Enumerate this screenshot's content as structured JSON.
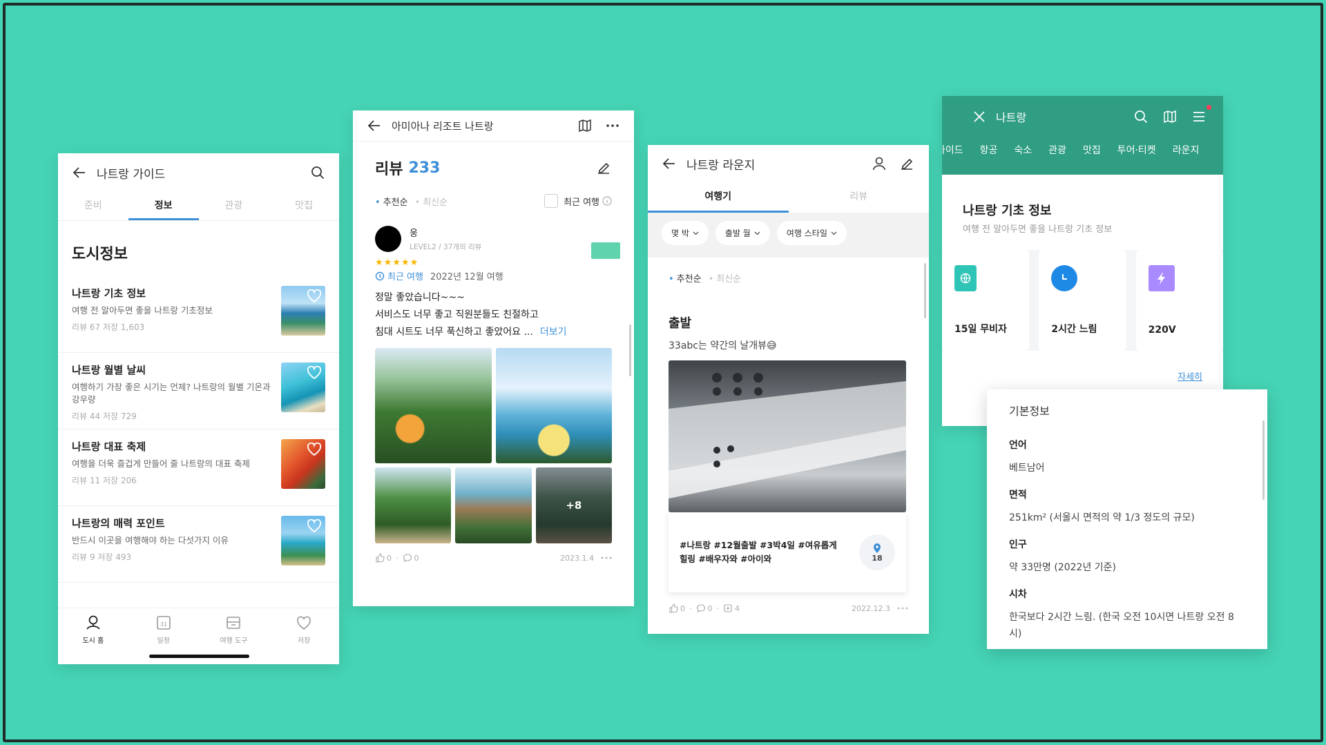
{
  "guide": {
    "title": "나트랑 가이드",
    "tabs": [
      "준비",
      "정보",
      "관광",
      "맛집"
    ],
    "active_tab": 1,
    "section_title": "도시정보",
    "items": [
      {
        "title": "나트랑 기초 정보",
        "desc": "여행 전 알아두면 좋을 나트랑 기초정보",
        "stats": "리뷰 67   저장 1,603"
      },
      {
        "title": "나트랑 월별 날씨",
        "desc": "여행하기 가장 좋은 시기는 언제? 나트랑의 월별 기온과 강우량",
        "stats": "리뷰 44   저장 729"
      },
      {
        "title": "나트랑 대표 축제",
        "desc": "여행을 더욱 즐겁게 만들어 줄 나트랑의 대표 축제",
        "stats": "리뷰 11   저장 206"
      },
      {
        "title": "나트랑의 매력 포인트",
        "desc": "반드시 이곳을 여행해야 하는 다섯가지 이유",
        "stats": "리뷰 9   저장 493"
      }
    ],
    "bottom_nav": [
      "도시 홈",
      "일정",
      "여행 도구",
      "저장"
    ],
    "calendar_day": "31"
  },
  "review": {
    "header_title": "아미아나 리조트 나트랑",
    "title": "리뷰",
    "count": "233",
    "sort_recommended": "추천순",
    "sort_latest": "최신순",
    "recent_trip_filter": "최근 여행",
    "user_name": "웅",
    "user_level": "LEVEL2 / 37개의 리뷰",
    "stars": "★★★★★",
    "recent_trip_label": "최근 여행",
    "trip_date": "2022년 12월 여행",
    "body_lines": [
      "정말 좋았습니다~~~",
      "서비스도 너무 좋고 직원분들도 친절하고",
      "침대 시트도 너무 푹신하고 좋았어요 ..."
    ],
    "more": "더보기",
    "photo_more": "+8",
    "likes": "0",
    "comments": "0",
    "date": "2023.1.4"
  },
  "lounge": {
    "title": "나트랑 라운지",
    "tabs": [
      "여행기",
      "리뷰"
    ],
    "filters": [
      "몇 박",
      "출발 월",
      "여행 스타일"
    ],
    "sort_recommended": "추천순",
    "sort_latest": "최신순",
    "post_title": "출발",
    "post_sub": "33abc는 약간의 날개뷰😅",
    "tags": [
      "#나트랑 #12월출발 #3박4일 #여유롭게",
      "힐링 #배우자와 #아이와"
    ],
    "pin_count": "18",
    "likes": "0",
    "comments": "0",
    "saves": "4",
    "date": "2022.12.3"
  },
  "info": {
    "title": "나트랑",
    "categories": [
      "가이드",
      "항공",
      "숙소",
      "관광",
      "맛집",
      "투어·티켓",
      "라운지"
    ],
    "section_title": "나트랑 기초 정보",
    "section_sub": "여행 전 알아두면 좋을 나트랑 기초 정보",
    "cards": [
      {
        "label": "15일 무비자",
        "icon": "globe-icon",
        "color": "#2ec4b6"
      },
      {
        "label": "2시간 느림",
        "icon": "clock-icon",
        "color": "#1e88e5"
      },
      {
        "label": "220V",
        "icon": "bolt-icon",
        "color": "#a98bff"
      }
    ],
    "detail_link": "자세히"
  },
  "basic": {
    "title": "기본정보",
    "rows": [
      {
        "k": "언어",
        "v": "베트남어"
      },
      {
        "k": "면적",
        "v": "251km² (서울시 면적의 약 1/3 정도의 규모)"
      },
      {
        "k": "인구",
        "v": "약 33만명 (2022년 기준)"
      },
      {
        "k": "시차",
        "v": "한국보다 2시간 느림. (한국 오전 10시면 나트랑 오전 8시)"
      }
    ]
  },
  "colors": {
    "background": "#45d4b5",
    "accent": "#3d8fd8",
    "header_green": "#2f9e83"
  }
}
